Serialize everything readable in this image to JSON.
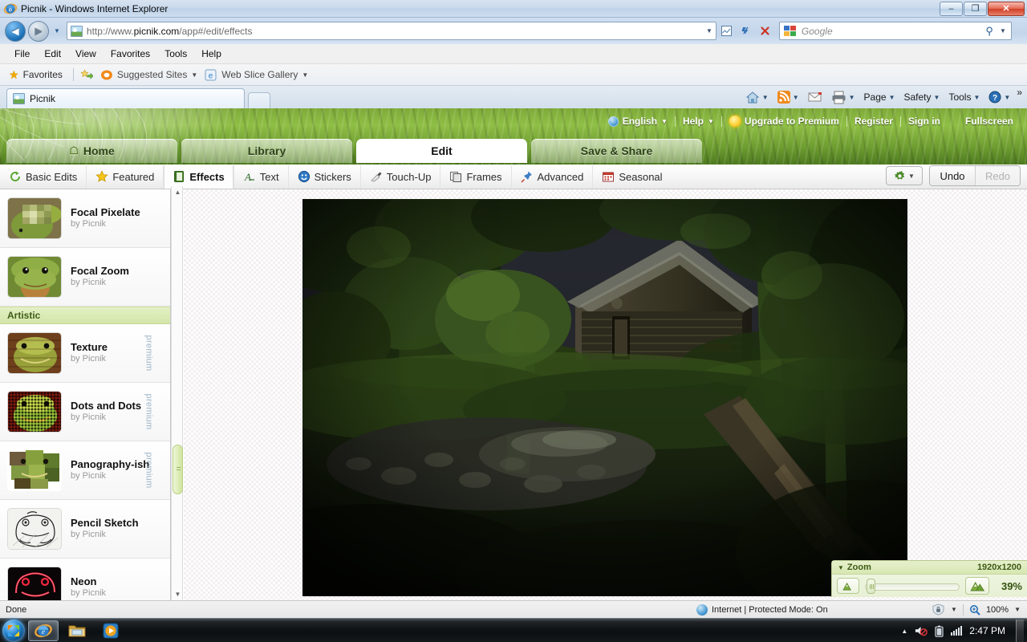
{
  "window": {
    "title": "Picnik - Windows Internet Explorer",
    "icon": "ie-icon",
    "minimize": "–",
    "maximize": "❐",
    "close": "✕"
  },
  "address_bar": {
    "back": "◀",
    "forward": "▶",
    "history_dropdown": "▼",
    "url_prefix": "http://www.",
    "url_domain": "picnik.com",
    "url_suffix": "/app#/edit/effects",
    "url_full": "http://www.picnik.com/app#/edit/effects",
    "compat_icon": "compatibility-view-icon",
    "refresh_icon": "↻",
    "stop_icon": "✕",
    "search_placeholder": "Google",
    "search_icon": "⌕",
    "search_dropdown": "▼"
  },
  "menu_bar": [
    "File",
    "Edit",
    "View",
    "Favorites",
    "Tools",
    "Help"
  ],
  "favorites_bar": {
    "favorites_label": "Favorites",
    "items": [
      {
        "label": "Suggested Sites",
        "caret": "▼"
      },
      {
        "label": "Web Slice Gallery",
        "caret": "▼"
      }
    ]
  },
  "browser_tabs": {
    "tabs": [
      {
        "label": "Picnik"
      }
    ],
    "new_tab": ""
  },
  "command_bar": {
    "items": [
      {
        "label": "",
        "icon": "home-icon",
        "caret": "▼"
      },
      {
        "label": "",
        "icon": "feeds-icon",
        "caret": "▼"
      },
      {
        "label": "",
        "icon": "mail-icon",
        "caret": ""
      },
      {
        "label": "",
        "icon": "print-icon",
        "caret": "▼"
      },
      {
        "label": "Page",
        "icon": "",
        "caret": "▼"
      },
      {
        "label": "Safety",
        "icon": "",
        "caret": "▼"
      },
      {
        "label": "Tools",
        "icon": "",
        "caret": "▼"
      },
      {
        "label": "",
        "icon": "help-icon",
        "caret": "▼"
      }
    ],
    "overflow": "»"
  },
  "picnik": {
    "top_nav": {
      "language": "English",
      "language_caret": "▼",
      "help": "Help",
      "help_caret": "▼",
      "upgrade": "Upgrade to Premium",
      "register": "Register",
      "signin": "Sign in",
      "fullscreen": "Fullscreen"
    },
    "main_tabs": [
      {
        "label": "Home",
        "icon": "home-icon",
        "active": false
      },
      {
        "label": "Library",
        "icon": "",
        "active": false
      },
      {
        "label": "Edit",
        "icon": "",
        "active": true
      },
      {
        "label": "Save & Share",
        "icon": "",
        "active": false
      }
    ],
    "effects_toolbar": [
      {
        "label": "Basic Edits",
        "icon": "refresh-circle-icon",
        "selected": false
      },
      {
        "label": "Featured",
        "icon": "star-icon",
        "selected": false
      },
      {
        "label": "Effects",
        "icon": "book-icon",
        "selected": true
      },
      {
        "label": "Text",
        "icon": "text-icon",
        "selected": false
      },
      {
        "label": "Stickers",
        "icon": "smiley-icon",
        "selected": false
      },
      {
        "label": "Touch-Up",
        "icon": "lipstick-icon",
        "selected": false
      },
      {
        "label": "Frames",
        "icon": "frames-icon",
        "selected": false
      },
      {
        "label": "Advanced",
        "icon": "pushpin-icon",
        "selected": false
      },
      {
        "label": "Seasonal",
        "icon": "calendar-icon",
        "selected": false
      }
    ],
    "toolbar_right": {
      "gear_icon": "gear-icon",
      "gear_caret": "▼",
      "undo": "Undo",
      "redo": "Redo"
    },
    "sidebar": {
      "scroll_up": "▲",
      "scroll_down": "▼",
      "items": [
        {
          "type": "effect",
          "name": "Focal Pixelate",
          "author": "by Picnik",
          "premium": "",
          "thumb": "frog-pixelated"
        },
        {
          "type": "effect",
          "name": "Focal Zoom",
          "author": "by Picnik",
          "premium": "",
          "thumb": "frog-closeup"
        },
        {
          "type": "category",
          "name": "Artistic"
        },
        {
          "type": "effect",
          "name": "Texture",
          "author": "by Picnik",
          "premium": "premium",
          "thumb": "frog-texture"
        },
        {
          "type": "effect",
          "name": "Dots and Dots",
          "author": "by Picnik",
          "premium": "premium",
          "thumb": "frog-dots"
        },
        {
          "type": "effect",
          "name": "Panography-ish",
          "author": "by Picnik",
          "premium": "premium",
          "thumb": "frog-panography"
        },
        {
          "type": "effect",
          "name": "Pencil Sketch",
          "author": "by Picnik",
          "premium": "",
          "thumb": "frog-sketch"
        },
        {
          "type": "effect",
          "name": "Neon",
          "author": "by Picnik",
          "premium": "",
          "thumb": "frog-neon"
        }
      ]
    },
    "canvas": {
      "photo_alt": "dark-forest-log-cabin-photo"
    },
    "zoom_panel": {
      "caret": "▼",
      "title": "Zoom",
      "dimensions": "1920x1200",
      "zoom_out_icon": "small-mountain-icon",
      "zoom_in_icon": "large-mountain-icon",
      "percent": "39%",
      "slider_value": 6
    }
  },
  "status_bar": {
    "status": "Done",
    "zone": "Internet | Protected Mode: On",
    "zone_icon": "globe-icon",
    "protected_icon": "shield-icon",
    "protected_caret": "▼",
    "zoom_icon": "magnifier-icon",
    "zoom_level": "100%",
    "zoom_caret": "▼"
  },
  "taskbar": {
    "start": "start-orb",
    "items": [
      {
        "icon": "ie-icon",
        "active": true
      },
      {
        "icon": "explorer-folder-icon",
        "active": false
      },
      {
        "icon": "media-player-icon",
        "active": false
      }
    ],
    "tray": {
      "show_hidden": "▲",
      "volume_icon": "volume-muted-icon",
      "battery_icon": "battery-icon",
      "network_icon": "network-bars-icon",
      "clock": "2:47 PM"
    }
  },
  "colors": {
    "picnik_green": "#8fbf45",
    "category_green": "#d3e6a8",
    "premium_blue": "#9db5c7",
    "accent_blue": "#1a6fb5"
  }
}
